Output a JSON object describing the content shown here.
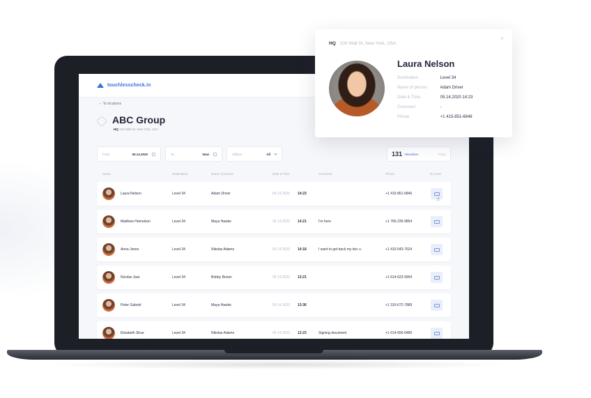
{
  "app": {
    "logo": "touchlesscheck.in",
    "back_link": "To locations",
    "group_title": "ABC Group",
    "hq_label": "HQ",
    "hq_address": "100 Wall St, New York, USA"
  },
  "filters": {
    "from_label": "From",
    "from_value": "05.14.2020",
    "to_label": "To",
    "to_value": "Now",
    "offices_label": "Offices",
    "offices_value": "All",
    "attendees_count": "131",
    "attendees_label": "Attendees",
    "extra_label": "Today"
  },
  "table": {
    "headers": [
      "Name",
      "Destination",
      "Name of person",
      "Date & Time",
      "Comment",
      "Phone",
      "ID Card"
    ],
    "rows": [
      {
        "name": "Laura Nelson",
        "destination": "Level 34",
        "person": "Adam Driver",
        "date": "05.14.2020",
        "time": "14:23",
        "comment": "",
        "phone": "+1 415-851-6846"
      },
      {
        "name": "Matthew Hamelson",
        "destination": "Level 34",
        "person": "Maya Hawke",
        "date": "05.14.2020",
        "time": "14:21",
        "comment": "I'm here",
        "phone": "+1 765-235-9854"
      },
      {
        "name": "Anna Jones",
        "destination": "Level 34",
        "person": "Nikolas Adams",
        "date": "05.14.2020",
        "time": "14:18",
        "comment": "I want to get back my doc u",
        "phone": "+1 410-543-7624"
      },
      {
        "name": "Nicolas Jaar",
        "destination": "Level 34",
        "person": "Bobby Brown",
        "date": "05.14.2020",
        "time": "13:21",
        "comment": "",
        "phone": "+1 614-623-9904"
      },
      {
        "name": "Peter Gabriel",
        "destination": "Level 34",
        "person": "Maya Hawke",
        "date": "05.14.2020",
        "time": "13:36",
        "comment": "",
        "phone": "+1 310-672-7889"
      },
      {
        "name": "Elisabeth Shue",
        "destination": "Level 34",
        "person": "Nikolas Adams",
        "date": "05.14.2020",
        "time": "12:23",
        "comment": "Signing document",
        "phone": "+1 614-556-5485"
      }
    ]
  },
  "popup": {
    "hq_label": "HQ",
    "hq_address": "100 Wall St, New York, USA",
    "name": "Laura Nelson",
    "fields": [
      {
        "label": "Destination",
        "value": "Level 34"
      },
      {
        "label": "Name of person",
        "value": "Adam Driver"
      },
      {
        "label": "Date & Time",
        "value": "05.14.2020 14:23"
      },
      {
        "label": "Comment",
        "value": "-"
      },
      {
        "label": "Phone",
        "value": "+1 415-851-6846"
      }
    ],
    "close_icon": "×"
  },
  "colors": {
    "accent": "#3b6fe0",
    "laptop": "#1d1f27",
    "screen_bg": "#f6f7fa"
  }
}
